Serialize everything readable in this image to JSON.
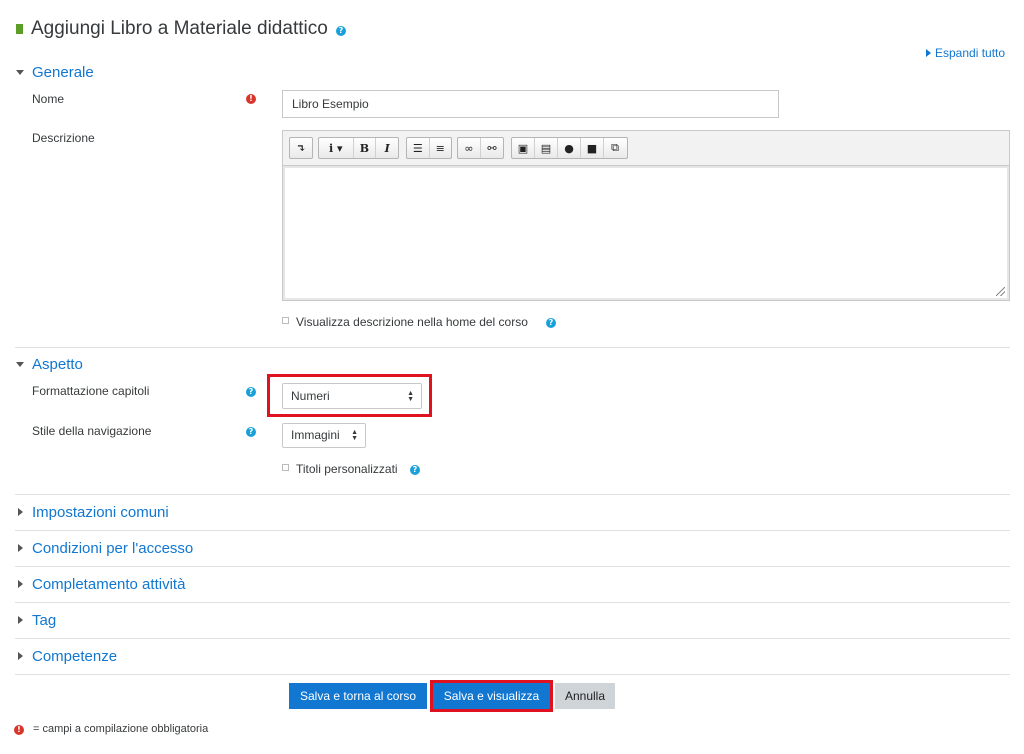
{
  "page": {
    "title": "Aggiungi Libro a Materiale didattico",
    "expand_all": "Espandi tutto"
  },
  "sections": {
    "generale": "Generale",
    "aspetto": "Aspetto",
    "impostazioni": "Impostazioni comuni",
    "condizioni": "Condizioni per l'accesso",
    "completamento": "Completamento attività",
    "tag": "Tag",
    "competenze": "Competenze"
  },
  "fields": {
    "nome_label": "Nome",
    "nome_value": "Libro Esempio",
    "descrizione_label": "Descrizione",
    "show_description_label": "Visualizza descrizione nella home del corso",
    "formattazione_label": "Formattazione capitoli",
    "formattazione_value": "Numeri",
    "stile_label": "Stile della navigazione",
    "stile_value": "Immagini",
    "titoli_label": "Titoli personalizzati"
  },
  "buttons": {
    "save_return": "Salva e torna al corso",
    "save_display": "Salva e visualizza",
    "cancel": "Annulla"
  },
  "footer": {
    "required_note": "= campi a compilazione obbligatoria"
  },
  "icons": {
    "book": "book-icon",
    "help": "help-icon",
    "required": "required-icon"
  },
  "colors": {
    "link_blue": "#1177d1",
    "primary_button": "#1177d1",
    "highlight_red": "#e0121f",
    "required_red": "#d9362b",
    "help_blue": "#1aa0d8",
    "book_green": "#5a9e28"
  }
}
